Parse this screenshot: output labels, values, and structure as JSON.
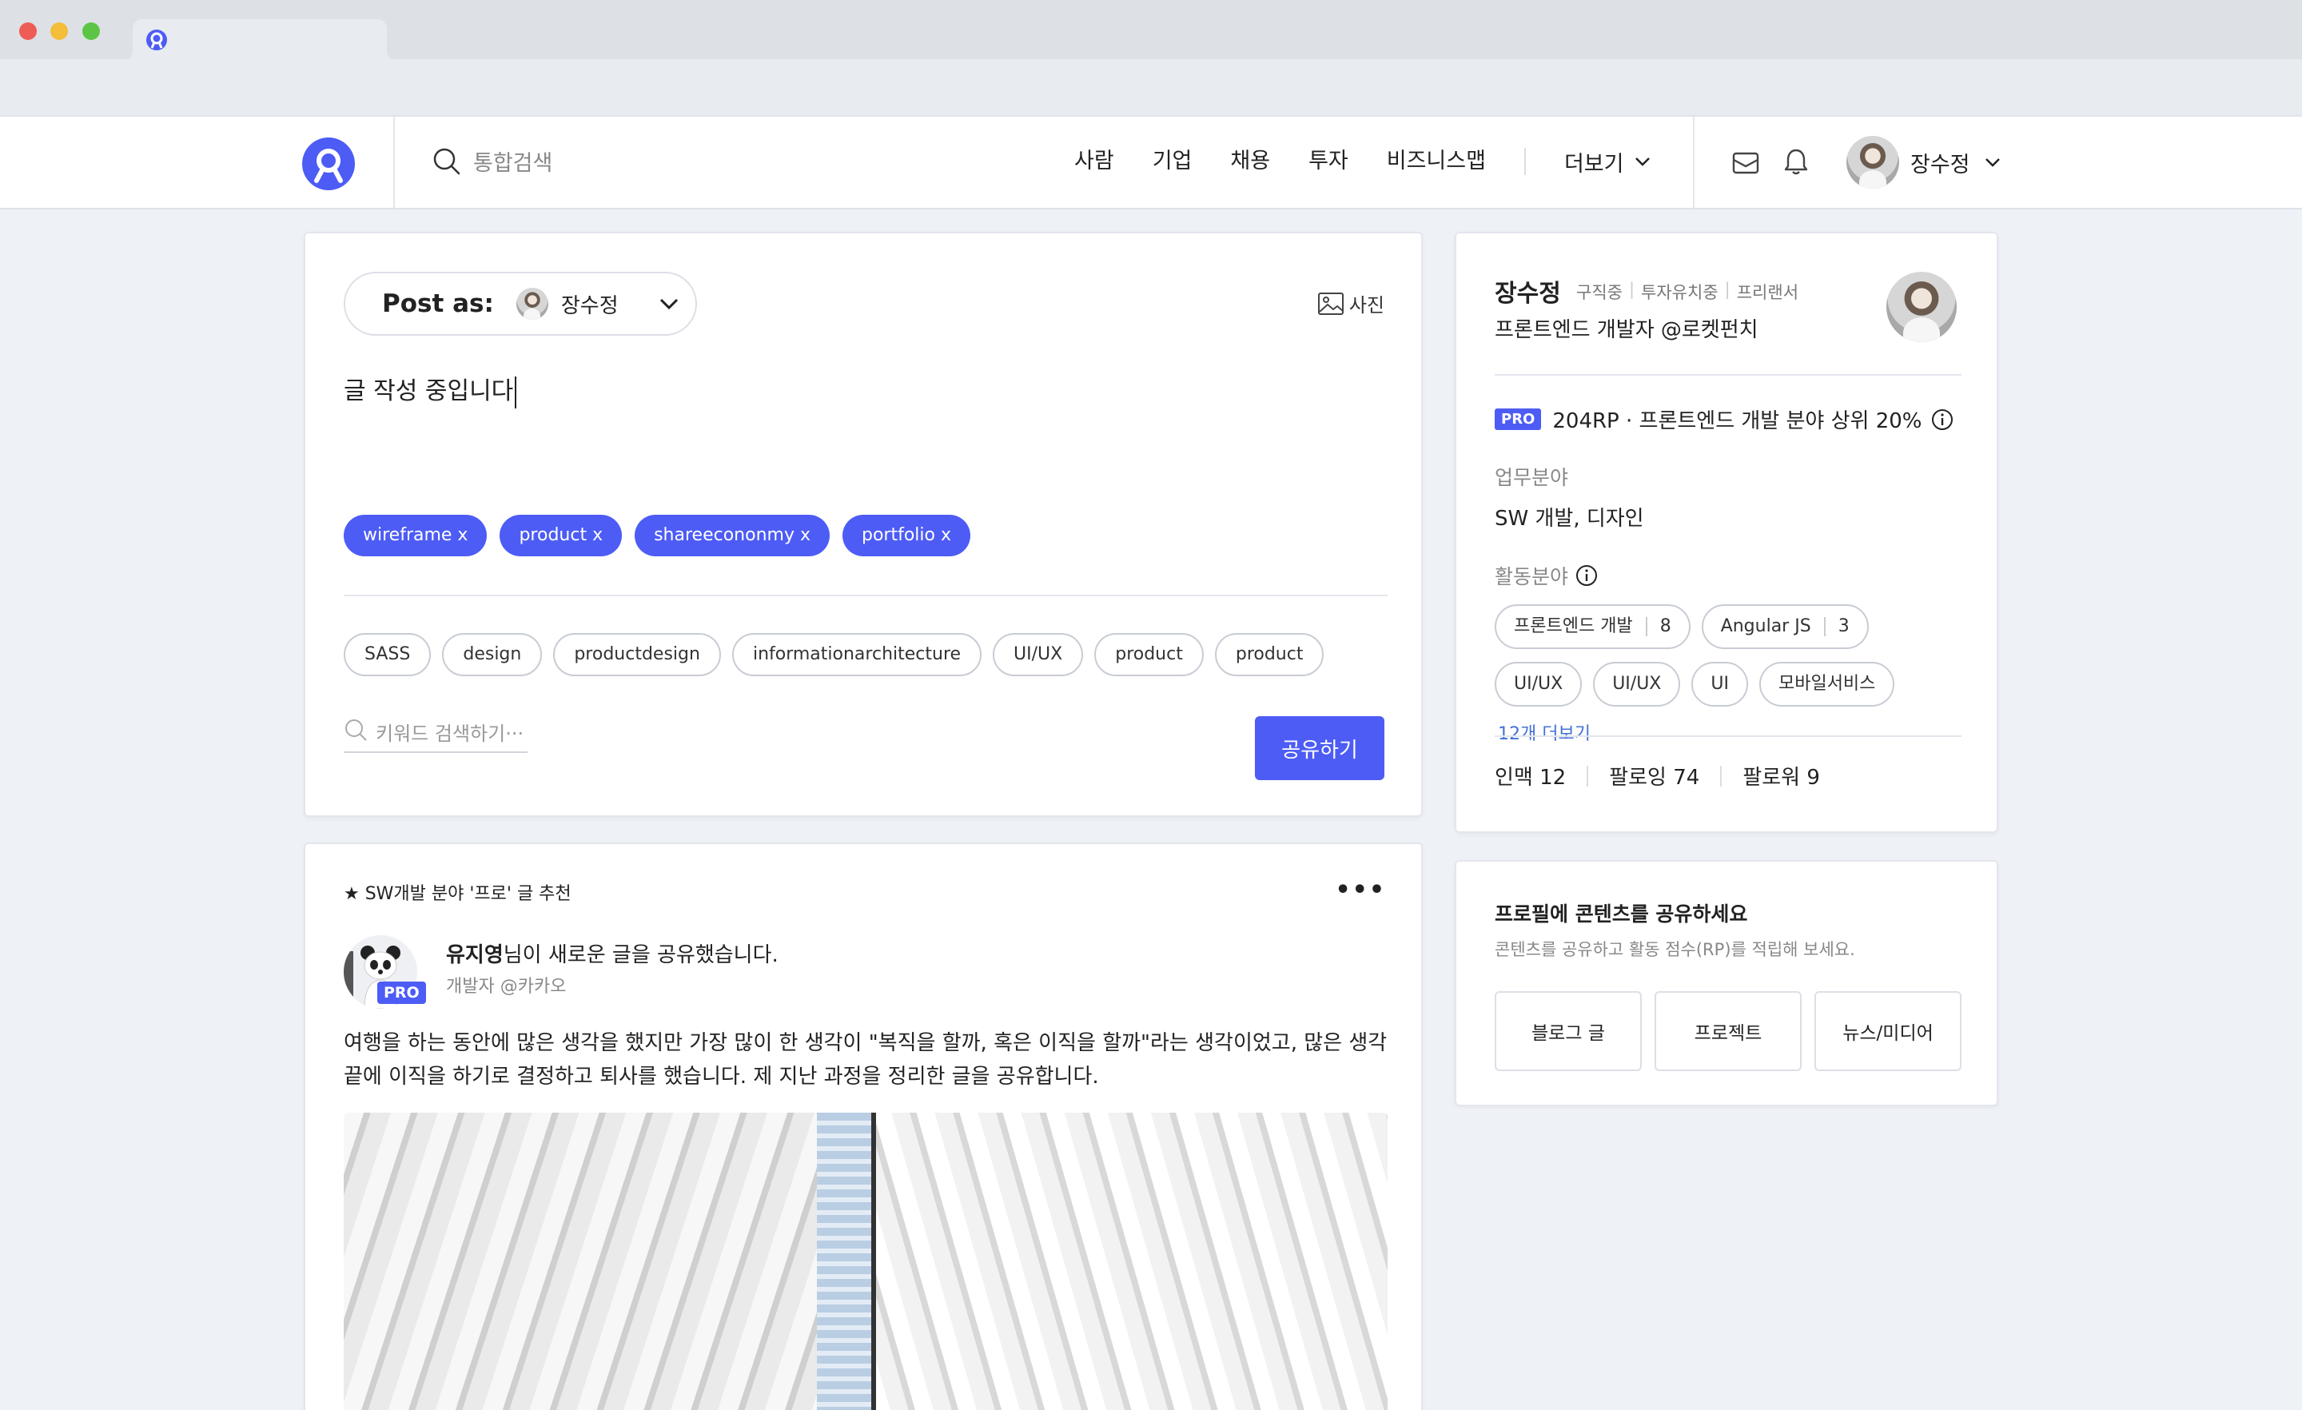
{
  "nav": {
    "search_placeholder": "통합검색",
    "links": [
      "사람",
      "기업",
      "채용",
      "투자",
      "비즈니스맵"
    ],
    "more": "더보기",
    "user_name": "장수정"
  },
  "composer": {
    "post_as_label": "Post as:",
    "post_as_name": "장수정",
    "photo_label": "사진",
    "text": "글 작성 중입니다",
    "selected_tags": [
      "wireframe x",
      "product x",
      "shareecononmy x",
      "portfolio x"
    ],
    "suggested_tags": [
      "SASS",
      "design",
      "productdesign",
      "informationarchitecture",
      "UI/UX",
      "product",
      "product"
    ],
    "keyword_placeholder": "키워드 검색하기···",
    "share_button": "공유하기"
  },
  "post": {
    "rec_label": "★ SW개발 분야 '프로' 글 추천",
    "more": "•••",
    "badge": "PRO",
    "author_name": "유지영",
    "author_action": "님이 새로운 글을 공유했습니다.",
    "author_sub": "개발자 @카카오",
    "body": "여행을 하는 동안에 많은 생각을 했지만 가장 많이 한 생각이 \"복직을 할까, 혹은 이직을 할까\"라는 생각이었고, 많은 생각 끝에 이직을 하기로 결정하고 퇴사를 했습니다. 제 지난 과정을 정리한 글을 공유합니다."
  },
  "profile": {
    "name": "장수정",
    "status": [
      "구직중",
      "투자유치중",
      "프리랜서"
    ],
    "title": "프론트엔드 개발자 @로켓펀치",
    "pro_badge": "PRO",
    "rp_text": "204RP · 프론트엔드 개발 분야 상위 20%",
    "work_label": "업무분야",
    "work_value": "SW 개발, 디자인",
    "activity_label": "활동분야",
    "tags": [
      {
        "label": "프론트엔드 개발",
        "count": "8"
      },
      {
        "label": "Angular JS",
        "count": "3"
      },
      {
        "label": "UI/UX",
        "count": ""
      },
      {
        "label": "UI/UX",
        "count": ""
      },
      {
        "label": "UI",
        "count": ""
      },
      {
        "label": "모바일서비스",
        "count": ""
      }
    ],
    "more_tags": "12개 더보기",
    "stats": [
      "인맥 12",
      "팔로잉 74",
      "팔로워 9"
    ]
  },
  "share_card": {
    "title": "프로필에 콘텐츠를 공유하세요",
    "subtitle": "콘텐츠를 공유하고 활동 점수(RP)를 적립해 보세요.",
    "buttons": [
      "블로그 글",
      "프로젝트",
      "뉴스/미디어"
    ]
  },
  "colors": {
    "accent": "#4d5cf5",
    "link": "#4470d6",
    "background": "#eef1f6"
  }
}
